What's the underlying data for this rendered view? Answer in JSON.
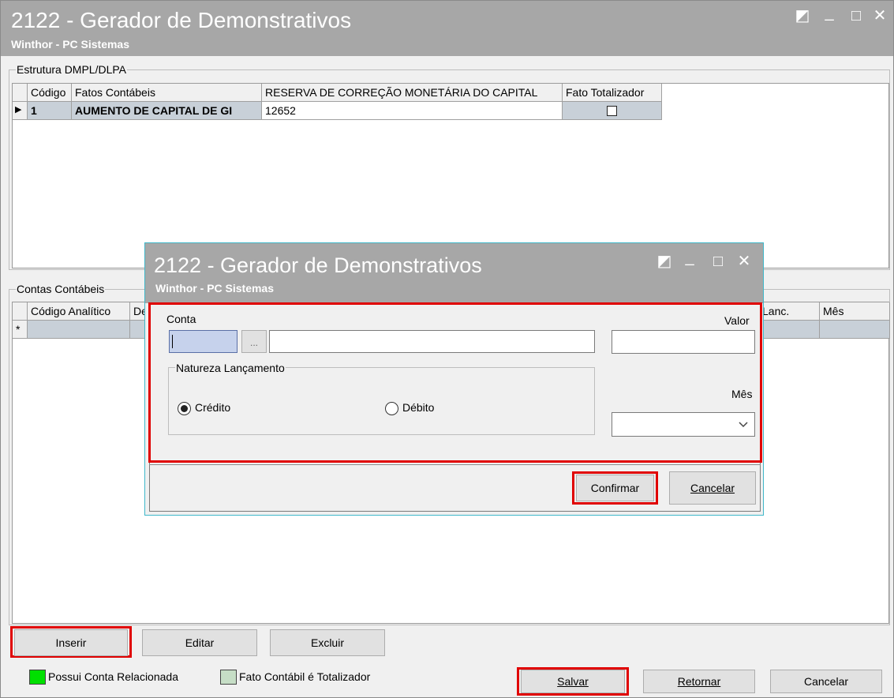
{
  "window": {
    "title": "2122 - Gerador de Demonstrativos",
    "subtitle": "Winthor - PC Sistemas",
    "controls": {
      "restore": "◩",
      "minimize": "_",
      "maximize": "□",
      "close": "✕"
    }
  },
  "estrutura": {
    "legend": "Estrutura DMPL/DLPA",
    "columns": [
      "Código",
      "Fatos Contábeis",
      "RESERVA DE CORREÇÃO MONETÁRIA DO CAPITAL",
      "Fato Totalizador"
    ],
    "rows": [
      {
        "marker": "▶",
        "codigo": "1",
        "fato": "AUMENTO DE CAPITAL DE GI",
        "reserva": "12652",
        "totalizador": false
      }
    ]
  },
  "contas": {
    "legend": "Contas Contábeis",
    "columns": [
      "Código Analítico",
      "De",
      "Lanc.",
      "Mês"
    ],
    "new_row_marker": "*"
  },
  "main_buttons": {
    "inserir": "Inserir",
    "editar": "Editar",
    "excluir": "Excluir"
  },
  "legend_items": [
    {
      "label": "Possui Conta Relacionada",
      "color": "#00e000"
    },
    {
      "label": "Fato Contábil é Totalizador",
      "color": "#c6dec6"
    }
  ],
  "bottom_buttons": {
    "salvar": "Salvar",
    "retornar": "Retornar",
    "cancelar": "Cancelar"
  },
  "dialog": {
    "title": "2122 - Gerador de Demonstrativos",
    "subtitle": "Winthor - PC Sistemas",
    "conta_label": "Conta",
    "browse_label": "...",
    "valor_label": "Valor",
    "natureza_label": "Natureza Lançamento",
    "credito_label": "Crédito",
    "debito_label": "Débito",
    "selected_natureza": "Crédito",
    "mes_label": "Mês",
    "confirmar": "Confirmar",
    "cancelar": "Cancelar"
  },
  "colors": {
    "titlebar": "#a7a7a7",
    "highlight": "#e00000",
    "dialog_border": "#3fb7c9"
  }
}
